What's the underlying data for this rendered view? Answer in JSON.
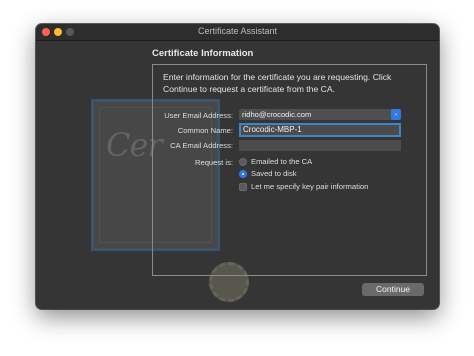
{
  "window": {
    "title": "Certificate Assistant"
  },
  "heading": "Certificate Information",
  "intro": "Enter information for the certificate you are requesting. Click Continue to request a certificate from the CA.",
  "form": {
    "email_label": "User Email Address:",
    "email_value": "ridho@crocodic.com",
    "common_name_label": "Common Name:",
    "common_name_value": "Crocodic-MBP-1",
    "ca_email_label": "CA Email Address:",
    "ca_email_value": "",
    "request_label": "Request is:",
    "options": [
      {
        "label": "Emailed to the CA",
        "selected": false
      },
      {
        "label": "Saved to disk",
        "selected": true
      }
    ],
    "keypair_label": "Let me specify key pair information",
    "keypair_checked": false
  },
  "continue_label": "Continue",
  "colors": {
    "accent": "#2f7ae5",
    "focus_ring": "#3f84c4",
    "window_bg": "#353535"
  },
  "icons": [
    "close-dot",
    "minimize-dot",
    "maximize-dot",
    "chevron-updown-icon",
    "certificate-icon"
  ]
}
